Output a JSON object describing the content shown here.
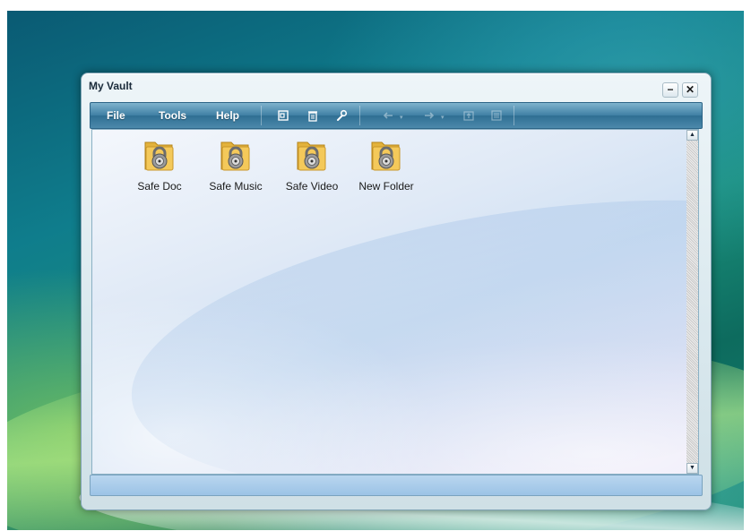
{
  "window": {
    "title": "My Vault",
    "minimize_label": "−",
    "close_label": "✕"
  },
  "menu": {
    "items": [
      "File",
      "Tools",
      "Help"
    ]
  },
  "toolbar": {
    "icons": [
      "new-window-icon",
      "trash-icon",
      "wrench-icon",
      "back-arrow-icon",
      "forward-arrow-icon",
      "folder-up-icon",
      "view-list-icon"
    ],
    "dropdown_glyph": "▾"
  },
  "folders": [
    {
      "label": "Safe Doc",
      "icon": "locked-folder-icon"
    },
    {
      "label": "Safe Music",
      "icon": "locked-folder-icon"
    },
    {
      "label": "Safe Video",
      "icon": "locked-folder-icon"
    },
    {
      "label": "New Folder",
      "icon": "locked-folder-icon"
    }
  ],
  "scrollbar": {
    "up_glyph": "▲",
    "down_glyph": "▼"
  },
  "colors": {
    "toolbar": "#3f7fa3",
    "folder": "#f4c95a",
    "lock": "#8a8a8a"
  }
}
